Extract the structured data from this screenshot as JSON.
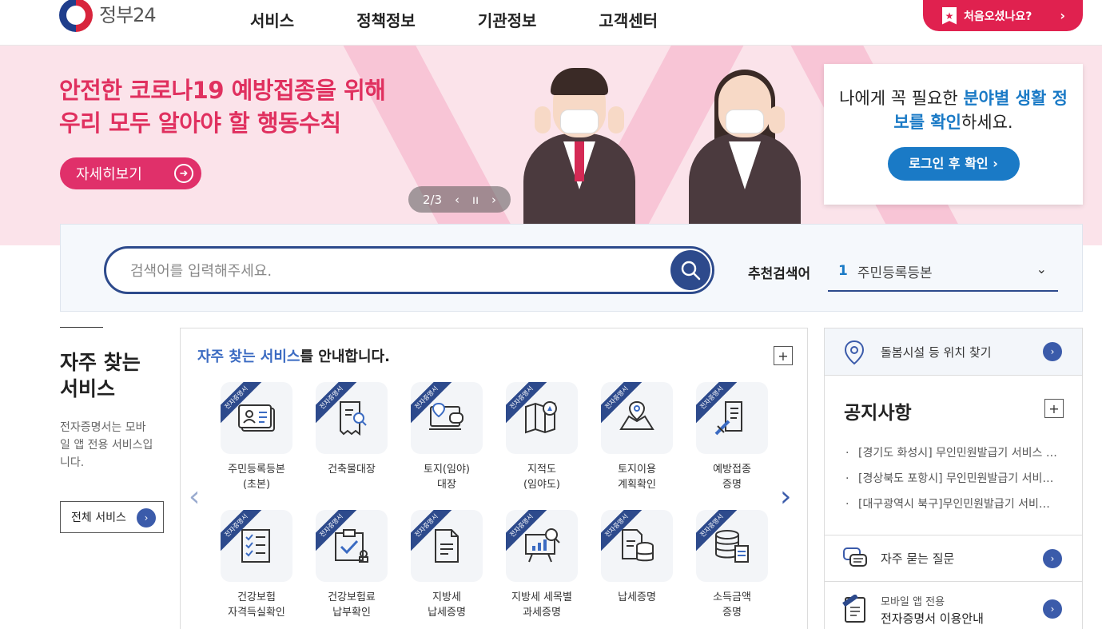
{
  "header": {
    "logo_text": "정부24",
    "nav": [
      "서비스",
      "정책정보",
      "기관정보",
      "고객센터"
    ],
    "first_visit_label": "처음오셨나요?",
    "first_visit_chevron": "›"
  },
  "banner": {
    "title_line1": "안전한 코로나19 예방접종을 위해",
    "title_line2": "우리 모두 알아야 할 행동수칙",
    "detail_label": "자세히보기",
    "slide_indicator": "2/3",
    "prev_glyph": "‹",
    "pause_glyph": "ıı",
    "next_glyph": "›"
  },
  "login_card": {
    "text_part1": "나에게 꼭 필요한 ",
    "text_highlight1": "분야별 생활 정보를 확인",
    "text_part2": "하세요.",
    "button_label": "로그인 후 확인 ›"
  },
  "search": {
    "placeholder": "검색어를 입력해주세요.",
    "recommend_label": "추천검색어",
    "recommend_rank": "1",
    "recommend_term": "주민등록등본"
  },
  "left": {
    "title": "자주 찾는 서비스",
    "desc": "전자증명서는 모바일 앱 전용 서비스입니다.",
    "all_service_label": "전체 서비스"
  },
  "services": {
    "heading_highlight": "자주 찾는 서비스",
    "heading_rest": "를 안내합니다.",
    "ribbon": "전자증명서",
    "items": [
      {
        "label": "주민등록등본\n(초본)",
        "icon": "id-card-icon"
      },
      {
        "label": "건축물대장",
        "icon": "document-search-icon"
      },
      {
        "label": "토지(임야)\n대장",
        "icon": "map-pin-chat-icon"
      },
      {
        "label": "지적도\n(임야도)",
        "icon": "map-compass-icon"
      },
      {
        "label": "토지이용\n계획확인",
        "icon": "map-location-icon"
      },
      {
        "label": "예방접종\n증명",
        "icon": "syringe-document-icon"
      },
      {
        "label": "건강보험\n자격득실확인",
        "icon": "checklist-icon"
      },
      {
        "label": "건강보험료\n납부확인",
        "icon": "clipboard-check-icon"
      },
      {
        "label": "지방세\n납세증명",
        "icon": "document-icon"
      },
      {
        "label": "지방세 세목별\n과세증명",
        "icon": "presentation-chart-icon"
      },
      {
        "label": "납세증명",
        "icon": "document-coins-icon"
      },
      {
        "label": "소득금액\n증명",
        "icon": "database-document-icon"
      }
    ]
  },
  "right": {
    "facility_label": "돌봄시설 등 위치 찾기",
    "notice_title": "공지사항",
    "notices": [
      "[경기도 화성시] 무인민원발급기 서비스 중단 안내",
      "[경상북도 포항시] 무인민원발급기 서비스 중단 안내",
      "[대구광역시 북구]무인민원발급기 서비스 중단 안내"
    ],
    "faq_label": "자주 묻는 질문",
    "mobile_sub": "모바일 앱 전용",
    "mobile_main": "전자증명서 이용안내"
  },
  "colors": {
    "brand_navy": "#2d4a8c",
    "accent_pink": "#e0214f",
    "accent_blue": "#1a7ac6"
  }
}
